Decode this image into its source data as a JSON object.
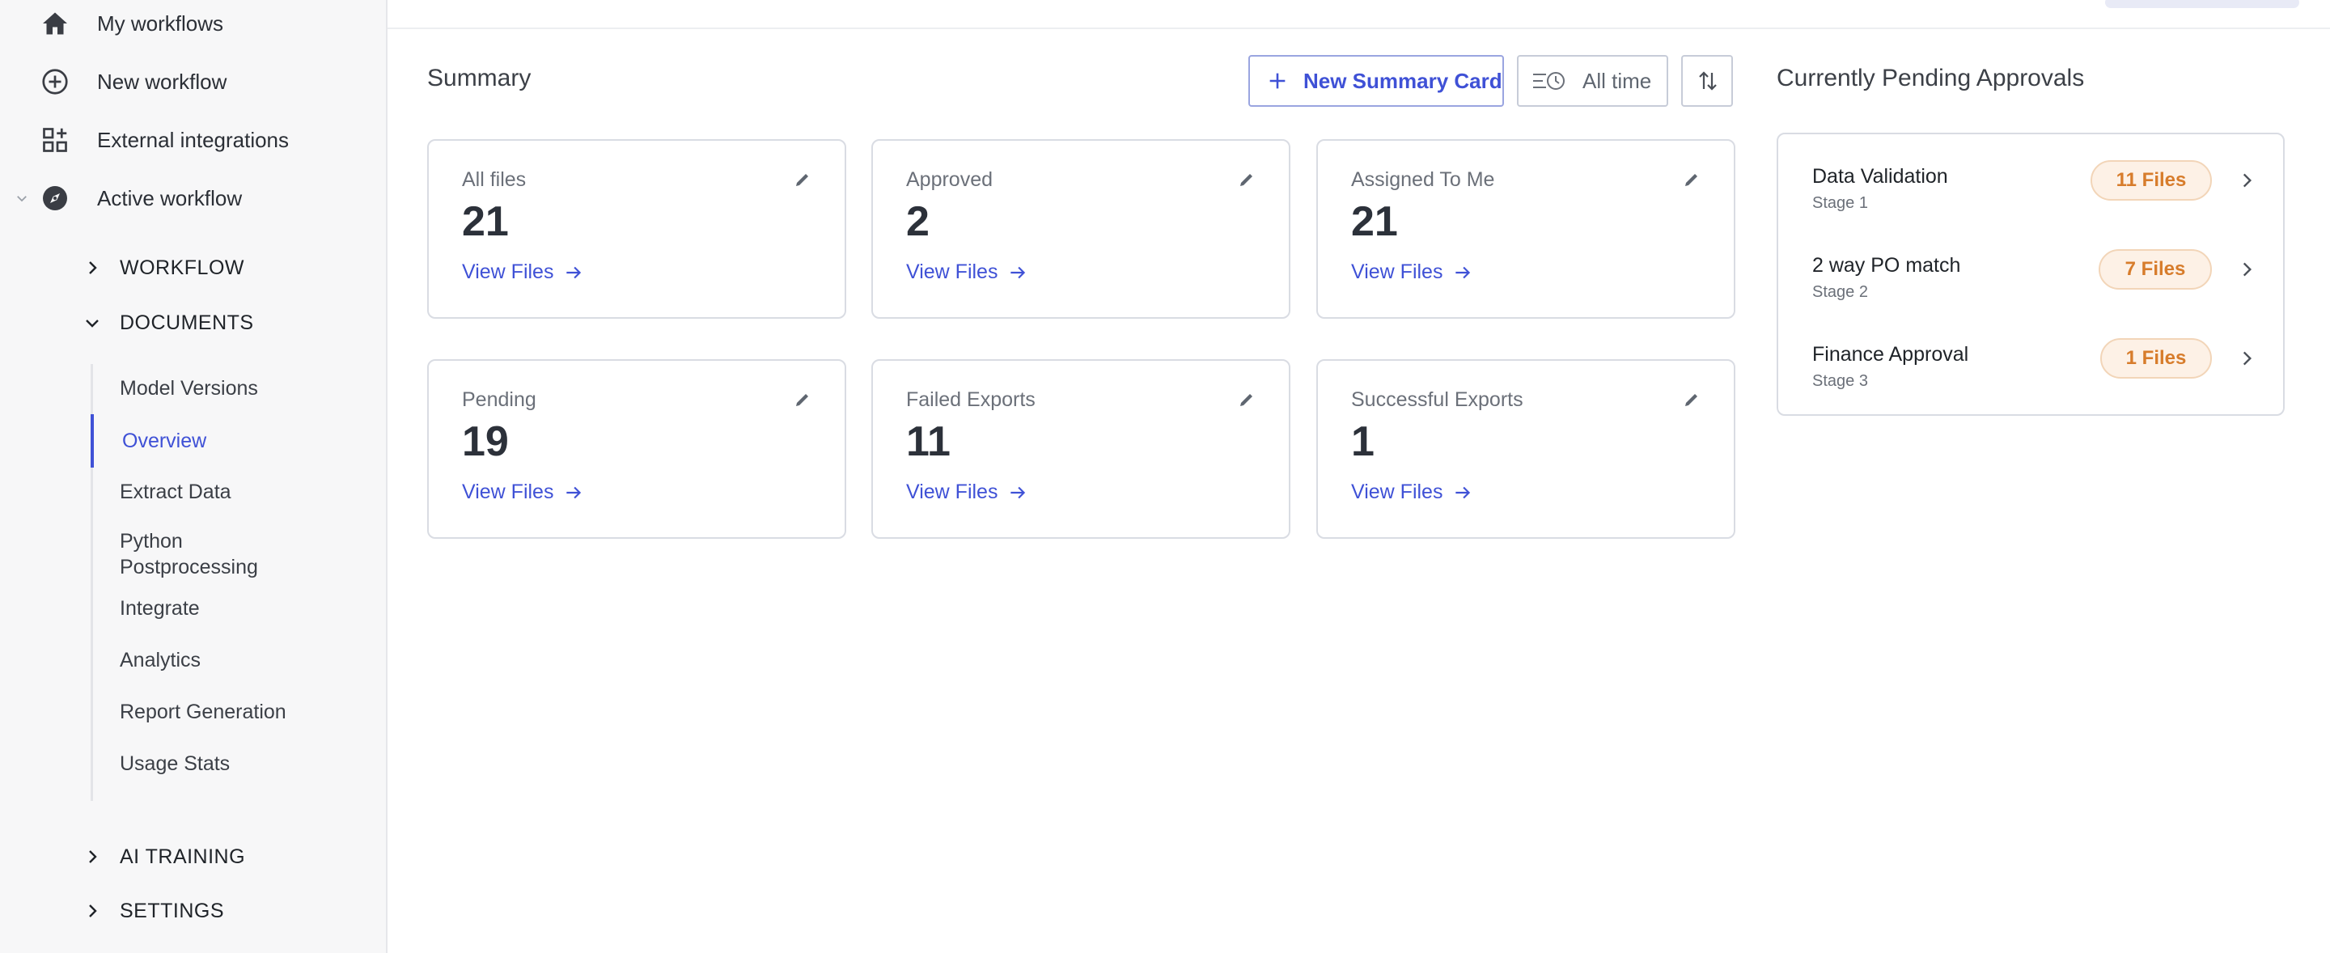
{
  "sidebar": {
    "nav": [
      {
        "label": "My workflows",
        "icon": "home-icon"
      },
      {
        "label": "New workflow",
        "icon": "plus-circle-icon"
      },
      {
        "label": "External integrations",
        "icon": "grid-add-icon"
      },
      {
        "label": "Active workflow",
        "icon": "compass-icon"
      }
    ],
    "sections": {
      "workflow": "WORKFLOW",
      "documents": "DOCUMENTS",
      "ai_training": "AI TRAINING",
      "settings": "SETTINGS"
    },
    "documents_items": [
      {
        "label": "Model Versions"
      },
      {
        "label": "Overview",
        "active": true
      },
      {
        "label": "Extract Data"
      },
      {
        "label": "Python Postprocessing"
      },
      {
        "label": "Integrate"
      },
      {
        "label": "Analytics"
      },
      {
        "label": "Report Generation"
      },
      {
        "label": "Usage Stats"
      }
    ]
  },
  "summary": {
    "title": "Summary",
    "new_card_label": "New Summary Card",
    "time_filter_label": "All time",
    "view_files_label": "View Files",
    "cards": [
      {
        "title": "All files",
        "value": "21"
      },
      {
        "title": "Approved",
        "value": "2"
      },
      {
        "title": "Assigned To Me",
        "value": "21"
      },
      {
        "title": "Pending",
        "value": "19"
      },
      {
        "title": "Failed Exports",
        "value": "11"
      },
      {
        "title": "Successful Exports",
        "value": "1"
      }
    ]
  },
  "pending": {
    "title": "Currently Pending Approvals",
    "rows": [
      {
        "name": "Data Validation",
        "stage": "Stage 1",
        "badge": "11 Files"
      },
      {
        "name": "2 way PO match",
        "stage": "Stage 2",
        "badge": "7 Files"
      },
      {
        "name": "Finance Approval",
        "stage": "Stage 3",
        "badge": "1 Files"
      }
    ]
  },
  "colors": {
    "accent": "#3f51d6",
    "badge_text": "#d77c2b",
    "badge_bg": "#fdf1e6",
    "sidebar_bg": "#f7f7f8"
  }
}
